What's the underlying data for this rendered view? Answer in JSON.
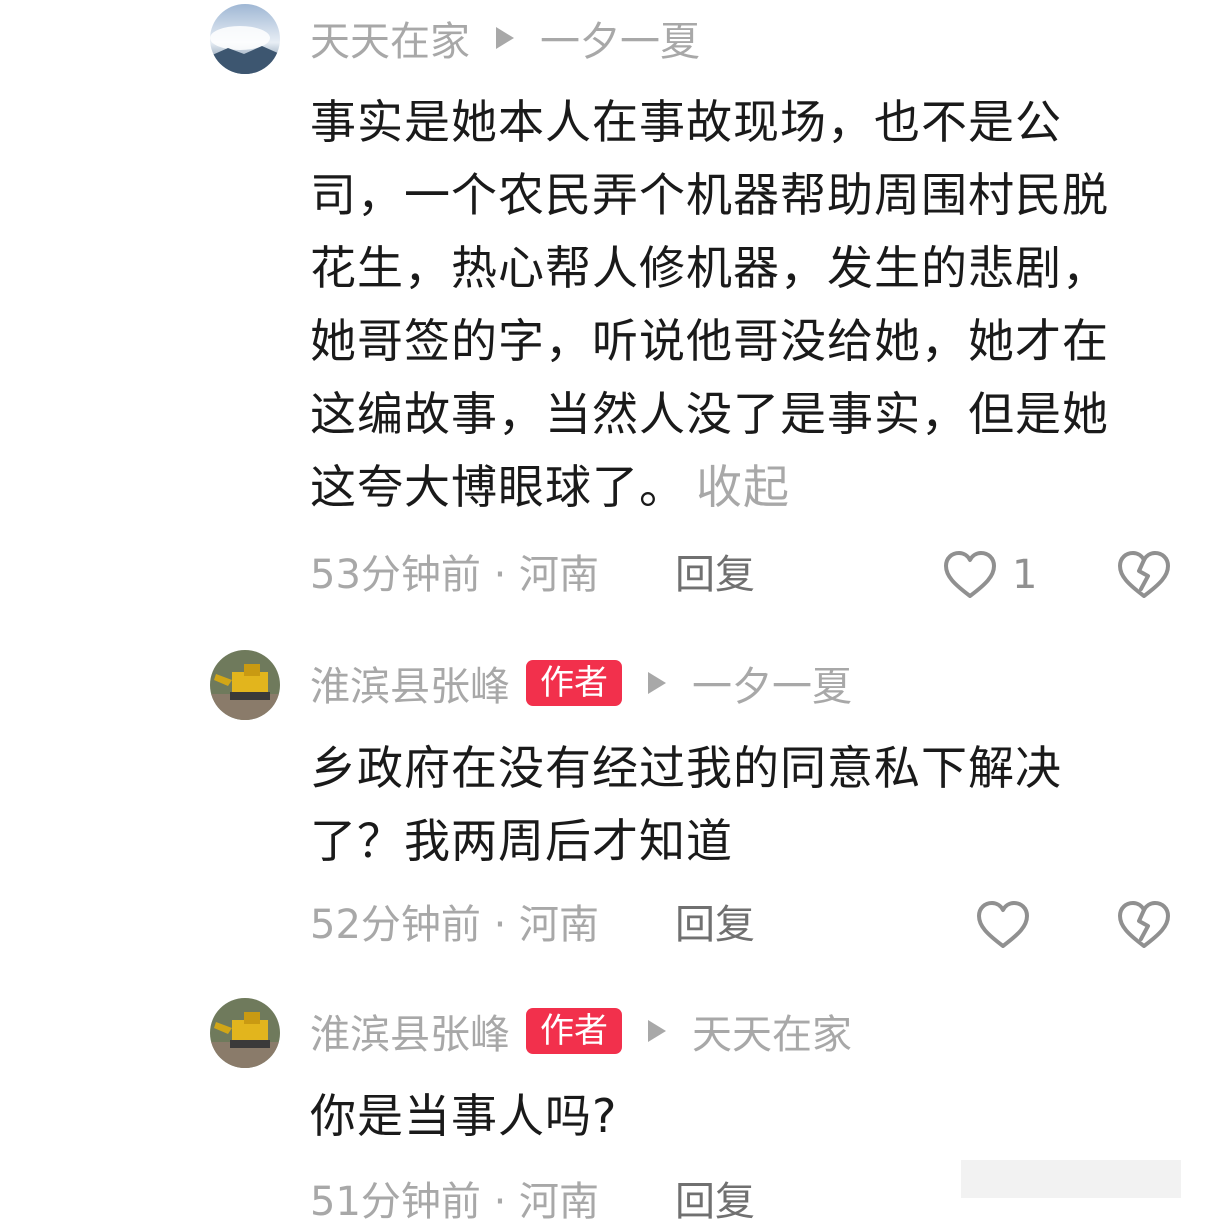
{
  "comments": [
    {
      "author": "天天在家",
      "reply_to": "一夕一夏",
      "badge": "",
      "text": "事实是她本人在事故现场，也不是公司，一个农民弄个机器帮助周围村民脱花生，热心帮人修机器，发生的悲剧，她哥签的字，听说他哥没给她，她才在这编故事，当然人没了是事实，但是她这夸大博眼球了。",
      "collapse_label": "收起",
      "time_location": "53分钟前 · 河南",
      "reply_label": "回复",
      "likes": "1"
    },
    {
      "author": "淮滨县张峰",
      "badge": "作者",
      "reply_to": "一夕一夏",
      "text": "乡政府在没有经过我的同意私下解决了？我两周后才知道",
      "time_location": "52分钟前 · 河南",
      "reply_label": "回复",
      "likes": ""
    },
    {
      "author": "淮滨县张峰",
      "badge": "作者",
      "reply_to": "天天在家",
      "text": "你是当事人吗?",
      "time_location": "51分钟前 · 河南",
      "reply_label": "回复",
      "likes": ""
    }
  ],
  "icons": {
    "like": "heart-outline-icon",
    "dislike": "broken-heart-icon",
    "reply_arrow": "play-triangle-icon"
  },
  "colors": {
    "badge_bg": "#f2304c",
    "meta_text": "#a8a8a8",
    "body_text": "#1a1a1a"
  }
}
